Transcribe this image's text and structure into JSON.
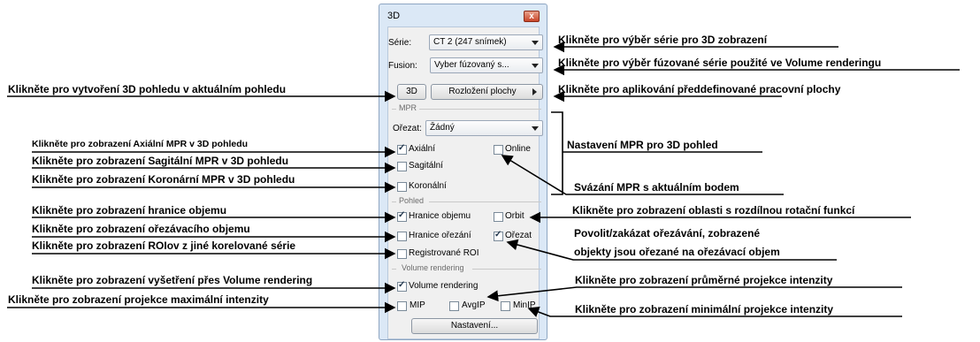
{
  "window": {
    "title": "3D",
    "close_glyph": "x"
  },
  "series": {
    "label": "Série:",
    "value": "CT 2 (247 snímek)"
  },
  "fusion": {
    "label": "Fusion:",
    "value": "Vyber fúzovaný s..."
  },
  "buttons": {
    "three_d": "3D",
    "layout": "Rozložení plochy",
    "settings": "Nastavení..."
  },
  "mpr": {
    "group_label": "MPR",
    "crop_label": "Ořezat:",
    "crop_value": "Žádný",
    "axial": {
      "label": "Axiální",
      "checked": true
    },
    "online": {
      "label": "Online",
      "checked": false
    },
    "sagittal": {
      "label": "Sagitální",
      "checked": false
    },
    "coronal": {
      "label": "Koronální",
      "checked": false
    }
  },
  "view": {
    "group_label": "Pohled",
    "volume_bounds": {
      "label": "Hranice objemu",
      "checked": true
    },
    "orbit": {
      "label": "Orbit",
      "checked": false
    },
    "crop_bounds": {
      "label": "Hranice ořezání",
      "checked": false
    },
    "crop": {
      "label": "Ořezat",
      "checked": true
    },
    "registered_roi": {
      "label": "Registrované ROI",
      "checked": false
    }
  },
  "vr": {
    "group_label": "Volume rendering",
    "volume_rendering": {
      "label": "Volume rendering",
      "checked": true
    },
    "mip": {
      "label": "MIP",
      "checked": false
    },
    "avgip": {
      "label": "AvgIP",
      "checked": false
    },
    "minip": {
      "label": "MinIP",
      "checked": false
    }
  },
  "annotations": {
    "series": "Klikněte pro výběr série pro 3D zobrazení",
    "fusion": "Klikněte pro výběr fúzované série použité ve Volume renderingu",
    "three_d": "Klikněte pro vytvoření 3D pohledu v aktuálním pohledu",
    "layout": "Klikněte pro aplikování předdefinované pracovní plochy",
    "axial": "Klikněte pro zobrazení Axiální MPR v 3D pohledu",
    "mpr_settings": "Nastavení MPR pro 3D pohled",
    "sagittal": "Klikněte pro zobrazení Sagitální MPR v 3D pohledu",
    "coronal": "Klikněte pro zobrazení Koronární MPR v 3D pohledu",
    "online": "Svázání MPR s aktuálním bodem",
    "volume_bounds": "Klikněte pro zobrazení  hranice objemu",
    "orbit": "Klikněte pro zobrazení oblasti s rozdílnou rotační funkcí",
    "crop_bounds": "Klikněte pro zobrazení ořezávacího objemu",
    "crop_line1": "Povolit/zakázat    ořezávání,    zobrazené",
    "crop_line2": "objekty jsou ořezané na ořezávací objem",
    "registered_roi": "Klikněte pro zobrazení ROIov z jiné korelované série",
    "volume_rendering": "Klikněte pro zobrazení vyšetření přes Volume rendering",
    "avgip": "Klikněte pro zobrazení průměrné projekce intenzity",
    "mip": "Klikněte pro zobrazení projekce maximální intenzity",
    "minip": "Klikněte pro zobrazení minimální projekce intenzity"
  }
}
